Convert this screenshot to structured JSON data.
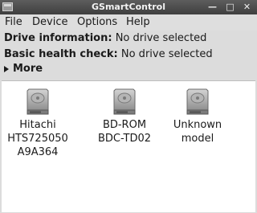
{
  "window": {
    "title": "GSmartControl"
  },
  "menubar": {
    "items": [
      {
        "label": "File"
      },
      {
        "label": "Device"
      },
      {
        "label": "Options"
      },
      {
        "label": "Help"
      }
    ]
  },
  "info": {
    "drive_information_label": "Drive information:",
    "drive_information_value": "No drive selected",
    "basic_health_label": "Basic health check:",
    "basic_health_value": "No drive selected",
    "more_label": "More"
  },
  "drives": [
    {
      "label": "Hitachi\nHTS725050\nA9A364",
      "icon": "hard-drive-icon"
    },
    {
      "label": "BD-ROM\nBDC-TD02",
      "icon": "hard-drive-icon"
    },
    {
      "label": "Unknown\nmodel",
      "icon": "hard-drive-icon"
    }
  ]
}
